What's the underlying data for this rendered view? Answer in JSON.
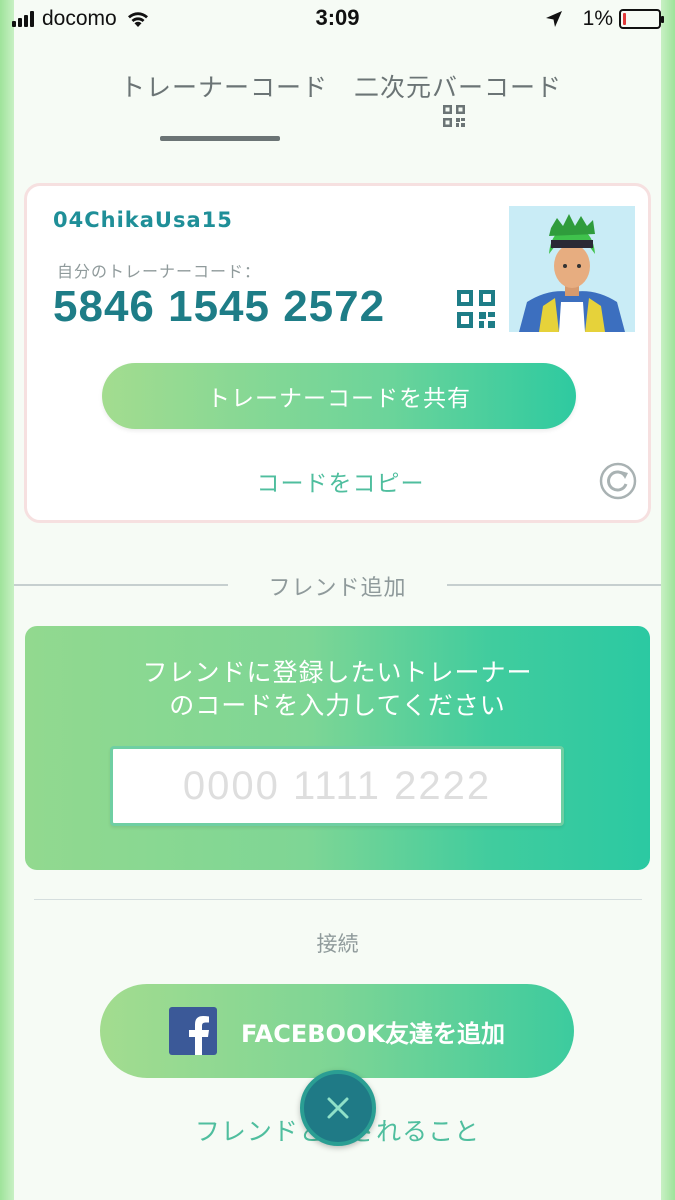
{
  "status_bar": {
    "carrier": "docomo",
    "time": "3:09",
    "battery_percent": "1%",
    "battery_level": 0.01
  },
  "tabs": [
    {
      "label": "トレーナーコード",
      "active": true
    },
    {
      "label": "二次元バーコード",
      "active": false
    }
  ],
  "trainer_card": {
    "username": "04ChikaUsa15",
    "code_label": "自分のトレーナーコード：",
    "code_value": "5846 1545 2572",
    "share_label": "トレーナーコードを共有",
    "copy_label": "コードをコピー"
  },
  "add_friend": {
    "section_label": "フレンド追加",
    "instruction": "フレンドに登録したいトレーナーのコードを入力してください",
    "input_placeholder": "0000 1111 2222",
    "input_value": ""
  },
  "connect": {
    "section_label": "接続",
    "facebook_label": "FACEBOOK友達を追加"
  },
  "footer": {
    "friend_link": "フレンドとでされること"
  },
  "colors": {
    "accent_teal": "#1e7d87",
    "accent_green": "#4fbe9e",
    "close_button": "#1f7a86",
    "facebook_blue": "#3b5998"
  },
  "icons": [
    "signal-icon",
    "wifi-icon",
    "location-arrow-icon",
    "battery-icon",
    "qr-code-icon",
    "refresh-icon",
    "facebook-icon",
    "close-icon"
  ]
}
